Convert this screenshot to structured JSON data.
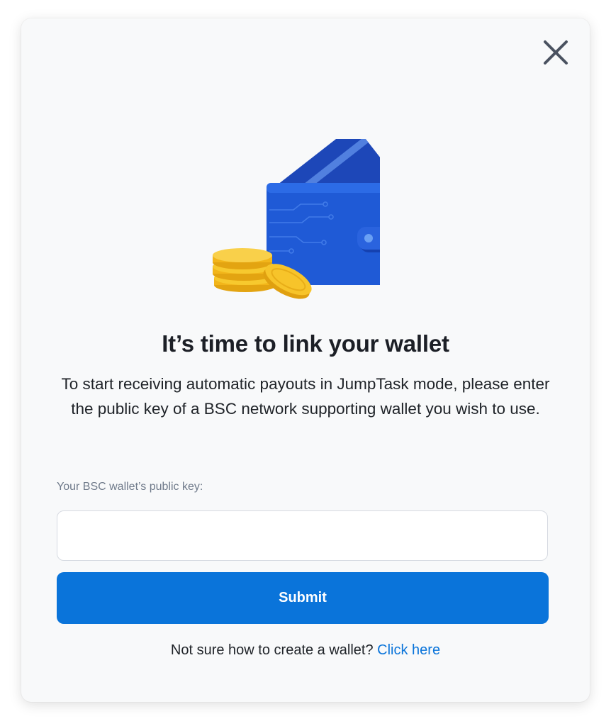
{
  "modal": {
    "title": "It’s time to link your wallet",
    "description": "To start receiving automatic payouts in JumpTask mode, please enter the public key of a BSC network supporting wallet you wish to use.",
    "field_label": "Your BSC wallet’s public key:",
    "input_value": "",
    "input_placeholder": "",
    "submit_label": "Submit",
    "help_text": "Not sure how to create a wallet?",
    "help_link": "Click here"
  },
  "icons": {
    "close": "close-icon",
    "illustration": "wallet-with-coins-icon"
  },
  "colors": {
    "accent": "#0a74da",
    "wallet_blue": "#1a4fc4",
    "coin_gold": "#f7c31a"
  }
}
